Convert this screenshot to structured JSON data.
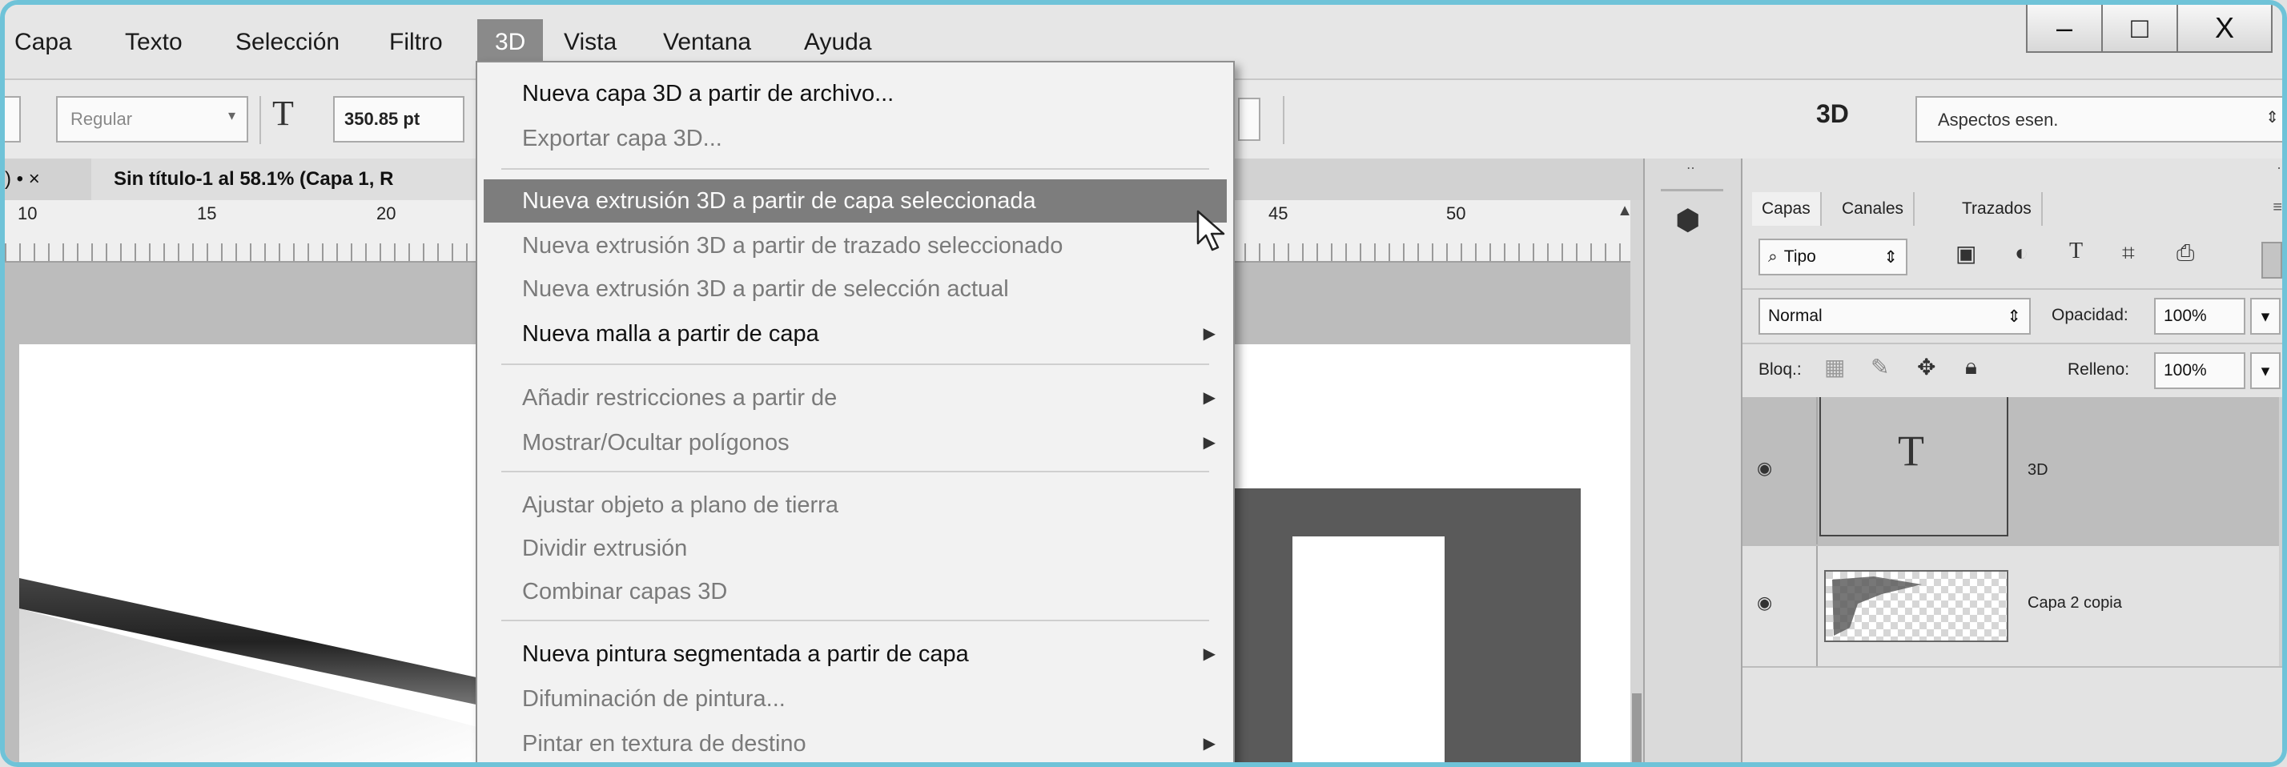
{
  "menubar": {
    "items": [
      "Capa",
      "Texto",
      "Selección",
      "Filtro",
      "3D",
      "Vista",
      "Ventana",
      "Ayuda"
    ],
    "active": "3D"
  },
  "window_controls": {
    "minimize": "–",
    "maximize": "□",
    "close": "X"
  },
  "options_bar": {
    "font_style": "Regular",
    "font_size_icon": "T",
    "font_size": "350.85 pt",
    "workspace_label": "3D",
    "workspace_select": "Aspectos esen."
  },
  "document": {
    "tab_title": "Sin título-1 al 58.1% (Capa 1, R",
    "tab_close": "×",
    "prev_tab_marker": ") • ×",
    "ruler_labels": [
      "10",
      "15",
      "20",
      "45",
      "50"
    ],
    "canvas_text": "3D"
  },
  "menu_3d": {
    "items": [
      {
        "label": "Nueva capa 3D a partir de archivo...",
        "enabled": true,
        "submenu": false
      },
      {
        "label": "Exportar capa 3D...",
        "enabled": false,
        "submenu": false
      },
      {
        "label": "Nueva extrusión 3D a partir de capa seleccionada",
        "enabled": true,
        "highlighted": true,
        "submenu": false
      },
      {
        "label": "Nueva extrusión 3D a partir de trazado seleccionado",
        "enabled": false,
        "submenu": false
      },
      {
        "label": "Nueva extrusión 3D a partir de selección actual",
        "enabled": false,
        "submenu": false
      },
      {
        "label": "Nueva malla a partir de capa",
        "enabled": true,
        "submenu": true
      },
      {
        "label": "Añadir restricciones a partir de",
        "enabled": false,
        "submenu": true
      },
      {
        "label": "Mostrar/Ocultar polígonos",
        "enabled": false,
        "submenu": true
      },
      {
        "label": "Ajustar objeto a plano de tierra",
        "enabled": false,
        "submenu": false
      },
      {
        "label": "Dividir extrusión",
        "enabled": false,
        "submenu": false
      },
      {
        "label": "Combinar capas 3D",
        "enabled": false,
        "submenu": false
      },
      {
        "label": "Nueva pintura segmentada a partir de capa",
        "enabled": true,
        "submenu": true
      },
      {
        "label": "Difuminación de pintura...",
        "enabled": false,
        "submenu": false
      },
      {
        "label": "Pintar en textura de destino",
        "enabled": false,
        "submenu": true
      }
    ]
  },
  "layers_panel": {
    "tabs": [
      "Capas",
      "Canales",
      "Trazados"
    ],
    "filter": "Tipo",
    "blend_mode": "Normal",
    "opacity_label": "Opacidad:",
    "opacity_value": "100%",
    "lock_label": "Bloq.:",
    "fill_label": "Relleno:",
    "fill_value": "100%",
    "layers": [
      {
        "name": "3D",
        "thumb": "T",
        "selected": true
      },
      {
        "name": "Capa 2 copia",
        "thumb": "",
        "selected": false
      }
    ]
  },
  "colors": {
    "accent_border": "#6fc3d8",
    "menu_highlight": "#7d7d7d",
    "disabled_text": "#7a7a7a"
  }
}
